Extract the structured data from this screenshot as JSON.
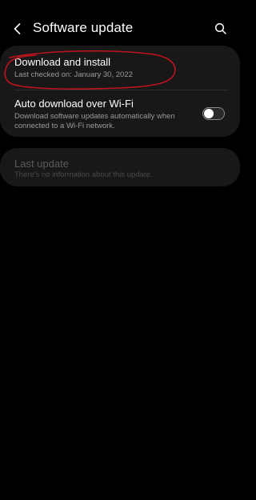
{
  "header": {
    "title": "Software update",
    "back_icon": "chevron-left-icon",
    "search_icon": "search-icon"
  },
  "settings": {
    "download": {
      "title": "Download and install",
      "subtitle": "Last checked on: January 30, 2022"
    },
    "auto_download": {
      "title": "Auto download over Wi-Fi",
      "subtitle_line1": "Download software updates automatically when",
      "subtitle_line2": "connected to a Wi-Fi network.",
      "enabled": false
    }
  },
  "last_update": {
    "title": "Last update",
    "subtitle": "There's no information about this update."
  },
  "colors": {
    "background": "#000000",
    "card": "#181818",
    "annotation": "#c0141e"
  }
}
